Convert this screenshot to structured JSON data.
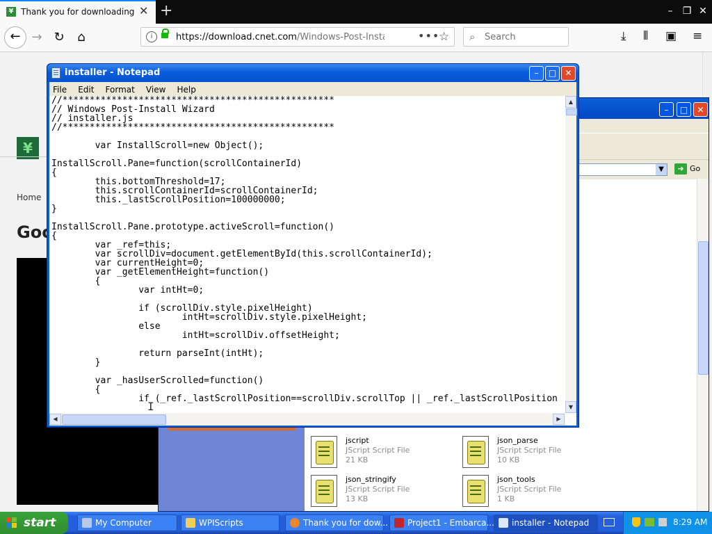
{
  "browser": {
    "tab_title": "Thank you for downloading Windo",
    "tab_favicon": "download-favicon",
    "url_host": "https://download.cnet.com",
    "url_path": "/Windows-Post-Install-Wiza",
    "more_label": "•••",
    "search_placeholder": "Search",
    "accent_color": "#0a84ff"
  },
  "webpage": {
    "home_link": "Home",
    "title_fragment": "Goo"
  },
  "explorer": {
    "go_label": "Go",
    "files": [
      {
        "name": "jscript",
        "type": "JScript Script File",
        "size": "21 KB"
      },
      {
        "name": "json_parse",
        "type": "JScript Script File",
        "size": "10 KB"
      },
      {
        "name": "json_stringify",
        "type": "JScript Script File",
        "size": "13 KB"
      },
      {
        "name": "json_tools",
        "type": "JScript Script File",
        "size": "1 KB"
      }
    ]
  },
  "notepad": {
    "title": "installer - Notepad",
    "menu": [
      "File",
      "Edit",
      "Format",
      "View",
      "Help"
    ],
    "content": "//**************************************************\n// Windows Post-Install Wizard\n// installer.js\n//**************************************************\n\n        var InstallScroll=new Object();\n\nInstallScroll.Pane=function(scrollContainerId)\n{\n        this.bottomThreshold=17;\n        this.scrollContainerId=scrollContainerId;\n        this._lastScrollPosition=100000000;\n}\n\nInstallScroll.Pane.prototype.activeScroll=function()\n{\n        var _ref=this;\n        var scrollDiv=document.getElementById(this.scrollContainerId);\n        var currentHeight=0;\n        var _getElementHeight=function()\n        {\n                var intHt=0;\n\n                if (scrollDiv.style.pixelHeight)\n                        intHt=scrollDiv.style.pixelHeight;\n                else\n                        intHt=scrollDiv.offsetHeight;\n\n                return parseInt(intHt);\n        }\n\n        var _hasUserScrolled=function()\n        {\n                if (_ref._lastScrollPosition==scrollDiv.scrollTop || _ref._lastScrollPosition"
  },
  "taskbar": {
    "start_label": "start",
    "items": [
      {
        "label": "My Computer",
        "icon": "computer-icon",
        "color": "#b8c8e8"
      },
      {
        "label": "WPIScripts",
        "icon": "folder-icon",
        "color": "#f2cf5b"
      },
      {
        "label": "Thank you for dow...",
        "icon": "firefox-icon",
        "color": "#e8862c"
      },
      {
        "label": "Project1 - Embarca...",
        "icon": "embarcadero-icon",
        "color": "#c0262b"
      },
      {
        "label": "installer - Notepad",
        "icon": "notepad-icon",
        "color": "#dbe8f8"
      }
    ],
    "clock": "8:29 AM"
  }
}
